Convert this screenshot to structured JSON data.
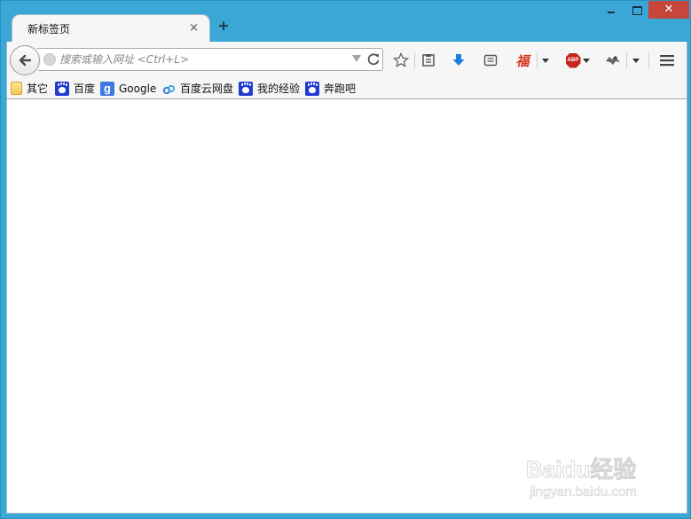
{
  "tab": {
    "title": "新标签页",
    "close_glyph": "×"
  },
  "new_tab_glyph": "+",
  "window_controls": {
    "close_glyph": "✕"
  },
  "urlbar": {
    "placeholder": "搜索或输入网址 <Ctrl+L>",
    "value": ""
  },
  "toolbar_icons": [
    "bookmark-star-icon",
    "reading-list-icon",
    "download-arrow-icon",
    "reader-icon",
    "fu-extension-icon",
    "adblock-plus-icon",
    "extension-icon",
    "menu-icon"
  ],
  "adblock": {
    "label": "ABP",
    "color": "#c7251f"
  },
  "fu_extension": {
    "glyph": "福",
    "color": "#d8361a"
  },
  "download_color": "#1f7fdc",
  "bookmarks": [
    {
      "label": "其它",
      "icon": "folder-icon"
    },
    {
      "label": "百度",
      "icon": "baidu-paw-icon"
    },
    {
      "label": "Google",
      "icon": "google-icon",
      "glyph": "g"
    },
    {
      "label": "百度云网盘",
      "icon": "baidu-cloud-icon"
    },
    {
      "label": "我的经验",
      "icon": "baidu-paw-icon"
    },
    {
      "label": "奔跑吧",
      "icon": "baidu-paw-icon"
    }
  ],
  "watermark": {
    "brand": "Baidu经验",
    "url": "jingyan.baidu.com"
  },
  "colors": {
    "frame": "#3aa7d6",
    "close_button": "#c7463b",
    "toolbar": "#f6f6f6"
  }
}
